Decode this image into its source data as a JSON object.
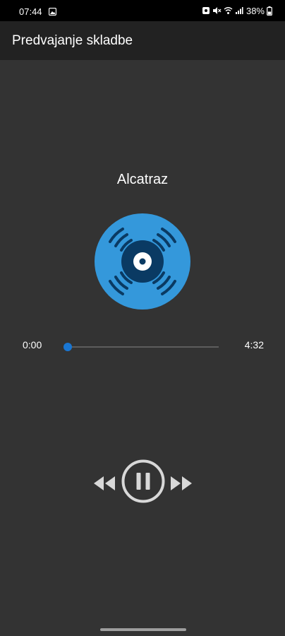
{
  "status_bar": {
    "time": "07:44",
    "battery": "38%",
    "icons": [
      "photo-icon",
      "screenshot-icon",
      "mute-icon",
      "wifi-icon",
      "signal-icon",
      "battery-icon"
    ]
  },
  "app_bar": {
    "title": "Predvajanje skladbe"
  },
  "player": {
    "song_title": "Alcatraz",
    "time_current": "0:00",
    "time_total": "4:32",
    "progress": 0.0,
    "state": "playing",
    "album_art_icon": "vinyl-record-icon",
    "controls": [
      "rewind-icon",
      "pause-icon",
      "fast-forward-icon"
    ]
  },
  "colors": {
    "background": "#333333",
    "app_bar": "#222222",
    "accent": "#1976d2",
    "record_light": "#3498db",
    "record_dark": "#0a3a63",
    "controls": "#d8d8d8"
  }
}
